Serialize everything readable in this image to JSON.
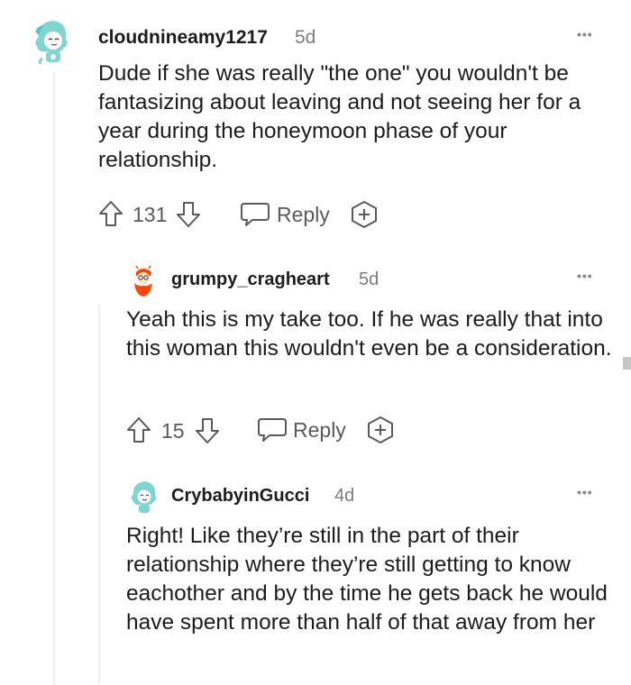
{
  "comments": [
    {
      "username": "cloudnineamy1217",
      "age": "5d",
      "text": "Dude if she was really \"the one\" you wouldn't be fantasizing about leaving and not seeing her for a year during the honeymoon phase of your relationship.",
      "votes": "131",
      "reply_label": "Reply",
      "avatar_icon": "avatar-teal-hair-icon"
    },
    {
      "username": "grumpy_cragheart",
      "age": "5d",
      "text": "Yeah this is my take too. If he was really that into this woman this wouldn't even be a consideration.",
      "votes": "15",
      "reply_label": "Reply",
      "avatar_icon": "avatar-orange-beard-icon"
    },
    {
      "username": "CrybabyinGucci",
      "age": "4d",
      "text": "Right! Like they’re still in the part of their relationship where they’re still getting to know eachother and by the time he gets back he would have spent more than half of that away from her",
      "avatar_icon": "avatar-teal-hair-icon"
    }
  ],
  "more_label": "•••",
  "colors": {
    "text": "#1c1c1c",
    "muted": "#7c7c7c",
    "icon": "#5a5a5a",
    "thread": "#edeff1"
  }
}
